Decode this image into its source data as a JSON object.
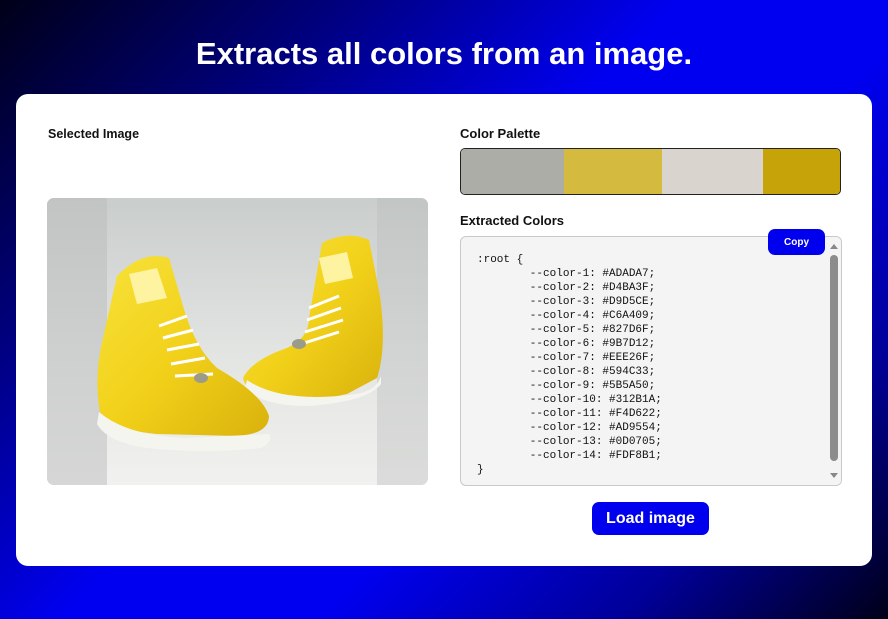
{
  "header": {
    "title": "Extracts all colors from an image."
  },
  "selected_image": {
    "label": "Selected Image"
  },
  "palette": {
    "label": "Color Palette",
    "swatches": [
      "#ADADA7",
      "#D4BA3F",
      "#D9D5CE",
      "#C6A409"
    ]
  },
  "extracted": {
    "label": "Extracted Colors",
    "copy_label": "Copy",
    "open_line": ":root {",
    "lines": [
      "--color-1: #ADADA7;",
      "--color-2: #D4BA3F;",
      "--color-3: #D9D5CE;",
      "--color-4: #C6A409;",
      "--color-5: #827D6F;",
      "--color-6: #9B7D12;",
      "--color-7: #EEE26F;",
      "--color-8: #594C33;",
      "--color-9: #5B5A50;",
      "--color-10: #312B1A;",
      "--color-11: #F4D622;",
      "--color-12: #AD9554;",
      "--color-13: #0D0705;",
      "--color-14: #FDF8B1;"
    ],
    "close_line": "}"
  },
  "actions": {
    "load_label": "Load image"
  }
}
